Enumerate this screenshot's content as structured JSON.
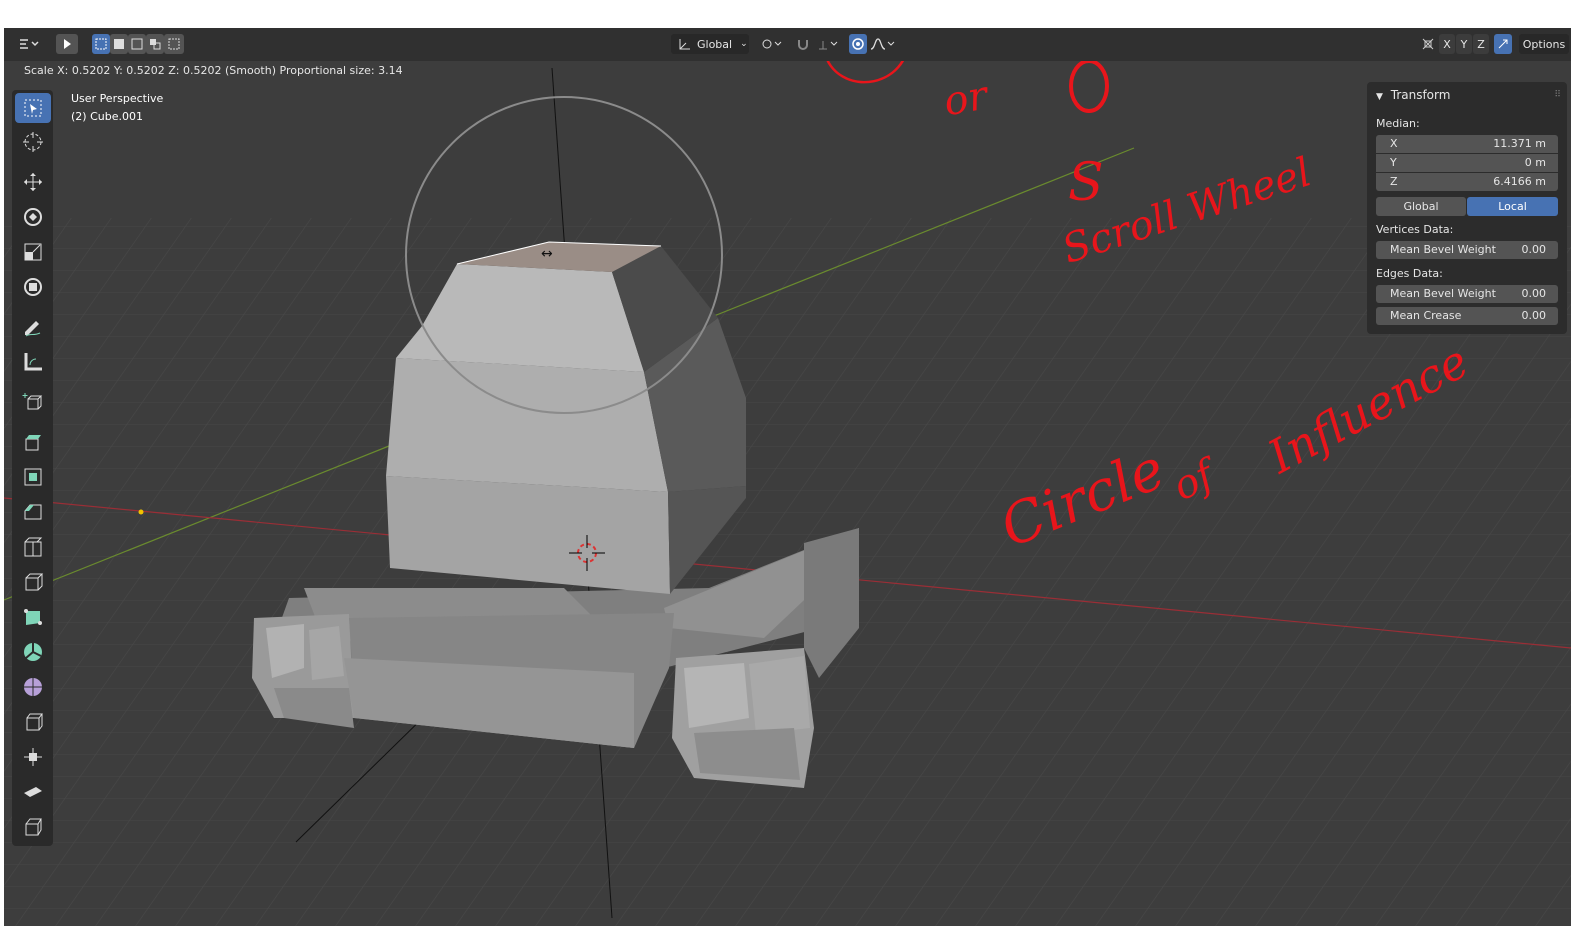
{
  "header": {
    "orientation": "Global",
    "axes": [
      "X",
      "Y",
      "Z"
    ],
    "options_label": "Options"
  },
  "status": {
    "operation_text": "Scale X: 0.5202  Y: 0.5202  Z: 0.5202 (Smooth) Proportional size: 3.14"
  },
  "viewport": {
    "perspective": "User Perspective",
    "object": "(2) Cube.001"
  },
  "toolbar": {
    "tools": [
      "select-box",
      "cursor",
      "move",
      "rotate",
      "scale",
      "transform",
      "annotate",
      "measure",
      "add-cube",
      "extrude",
      "inset",
      "bevel",
      "loop-cut",
      "knife",
      "poly-build",
      "spin",
      "smooth",
      "shrink-fatten",
      "shear",
      "to-sphere"
    ]
  },
  "transform_panel": {
    "title": "Transform",
    "median_label": "Median:",
    "x": {
      "label": "X",
      "value": "11.371 m"
    },
    "y": {
      "label": "Y",
      "value": "0 m"
    },
    "z": {
      "label": "Z",
      "value": "6.4166 m"
    },
    "global_label": "Global",
    "local_label": "Local",
    "vertices_label": "Vertices Data:",
    "vertex_bevel": {
      "label": "Mean Bevel Weight",
      "value": "0.00"
    },
    "edges_label": "Edges Data:",
    "edge_bevel": {
      "label": "Mean Bevel Weight",
      "value": "0.00"
    },
    "edge_crease": {
      "label": "Mean Crease",
      "value": "0.00"
    }
  },
  "annotations": {
    "or": "or",
    "letter_o": "O",
    "letter_s": "S",
    "scroll_wheel": "Scroll Wheel",
    "circle": "Circle",
    "of": "of",
    "influence": "Influence"
  },
  "colors": {
    "accent": "#4772b3",
    "annotation": "#e8151b",
    "viewport_bg": "#3d3d3d"
  }
}
